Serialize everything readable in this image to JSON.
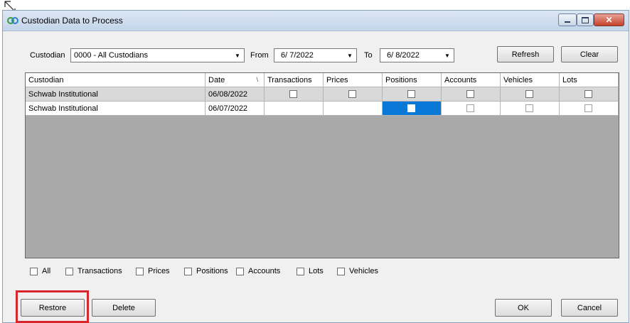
{
  "window": {
    "title": "Custodian Data to Process"
  },
  "filterbar": {
    "custodian_label": "Custodian",
    "custodian_value": "0000 - All Custodians",
    "from_label": "From",
    "from_value": "6/ 7/2022",
    "to_label": "To",
    "to_value": "6/ 8/2022",
    "refresh_label": "Refresh",
    "clear_label": "Clear"
  },
  "grid": {
    "columns": [
      "Custodian",
      "Date",
      "Transactions",
      "Prices",
      "Positions",
      "Accounts",
      "Vehicles",
      "Lots"
    ],
    "rows": [
      {
        "custodian": "Schwab Institutional",
        "date": "06/08/2022"
      },
      {
        "custodian": "Schwab Institutional",
        "date": "06/07/2022"
      }
    ]
  },
  "filters": [
    "All",
    "Transactions",
    "Prices",
    "Positions",
    "Accounts",
    "Lots",
    "Vehicles"
  ],
  "buttons": {
    "restore": "Restore",
    "delete": "Delete",
    "ok": "OK",
    "cancel": "Cancel"
  },
  "colors": {
    "selection": "#0a78d7",
    "highlight": "#d9262e",
    "grid_background": "#a9a9a9"
  }
}
